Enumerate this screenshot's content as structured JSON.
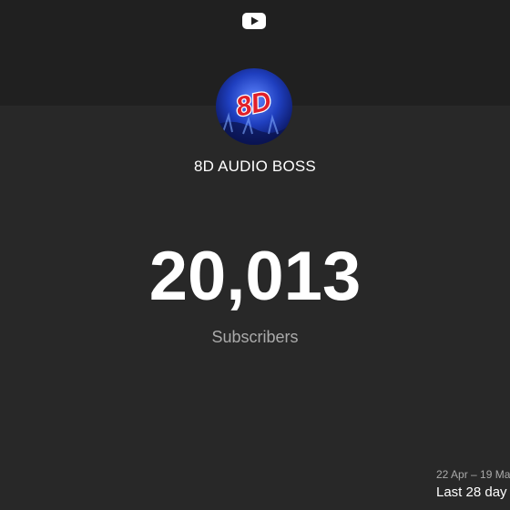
{
  "header": {
    "logo_icon": "youtube-logo-icon"
  },
  "channel": {
    "avatar_icon": "channel-avatar-8d",
    "avatar_text": "8D",
    "name": "8D AUDIO BOSS"
  },
  "stats": {
    "subscriber_count": "20,013",
    "subscriber_label": "Subscribers"
  },
  "footer": {
    "date_range": "22 Apr – 19 Ma",
    "period": "Last 28 day"
  },
  "colors": {
    "background": "#282828",
    "top_band": "#202020",
    "text_primary": "#ffffff",
    "text_secondary": "#aaaaaa",
    "avatar_blue": "#1f3fbf",
    "avatar_red": "#e0202a"
  }
}
